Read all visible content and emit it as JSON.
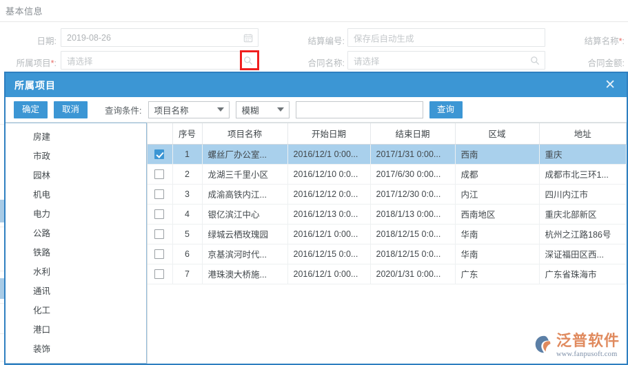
{
  "background_form": {
    "section_title": "基本信息",
    "fields": [
      {
        "label": "日期:",
        "required": false,
        "value": "2019-08-26",
        "placeholder": "",
        "icon": "calendar-icon"
      },
      {
        "label": "结算编号:",
        "required": false,
        "value": "",
        "placeholder": "保存后自动生成",
        "icon": ""
      },
      {
        "label": "结算名称",
        "required": true,
        "value": "",
        "placeholder": "",
        "icon": ""
      },
      {
        "label": "所属项目",
        "required": true,
        "value": "",
        "placeholder": "请选择",
        "icon": "search-icon"
      },
      {
        "label": "合同名称:",
        "required": false,
        "value": "",
        "placeholder": "请选择",
        "icon": "search-icon"
      },
      {
        "label": "合同金额:",
        "required": false,
        "value": "",
        "placeholder": "",
        "icon": ""
      }
    ],
    "highlight_color": "#f01f1f"
  },
  "dialog": {
    "title": "所属项目",
    "close_label": "✕",
    "accent_color": "#3c96d4",
    "toolbar": {
      "confirm_label": "确定",
      "cancel_label": "取消",
      "condition_label": "查询条件:",
      "field_select": "项目名称",
      "match_select": "模糊",
      "keyword_value": "",
      "keyword_placeholder": "",
      "query_label": "查询"
    },
    "sidebar": {
      "items": [
        "房建",
        "市政",
        "园林",
        "机电",
        "电力",
        "公路",
        "铁路",
        "水利",
        "通讯",
        "化工",
        "港口",
        "装饰"
      ]
    },
    "table": {
      "columns": [
        "",
        "序号",
        "项目名称",
        "开始日期",
        "结束日期",
        "区域",
        "地址"
      ],
      "rows": [
        {
          "checked": true,
          "selected": true,
          "index": "1",
          "name": "螺丝厂办公室...",
          "start": "2016/12/1 0:00...",
          "end": "2017/1/31 0:00...",
          "region": "西南",
          "address": "重庆"
        },
        {
          "checked": false,
          "selected": false,
          "index": "2",
          "name": "龙湖三千里小区",
          "start": "2016/12/10 0:0...",
          "end": "2017/6/30 0:00...",
          "region": "成都",
          "address": "成都市北三环1..."
        },
        {
          "checked": false,
          "selected": false,
          "index": "3",
          "name": "成渝高铁内江...",
          "start": "2016/12/12 0:0...",
          "end": "2017/12/30 0:0...",
          "region": "内江",
          "address": "四川内江市"
        },
        {
          "checked": false,
          "selected": false,
          "index": "4",
          "name": "银亿滨江中心",
          "start": "2016/12/13 0:0...",
          "end": "2018/1/13 0:00...",
          "region": "西南地区",
          "address": "重庆北部新区"
        },
        {
          "checked": false,
          "selected": false,
          "index": "5",
          "name": "绿城云栖玫瑰园",
          "start": "2016/12/1 0:00...",
          "end": "2018/12/15 0:0...",
          "region": "华南",
          "address": "杭州之江路186号"
        },
        {
          "checked": false,
          "selected": false,
          "index": "6",
          "name": "京基滨河时代...",
          "start": "2016/12/15 0:0...",
          "end": "2018/12/15 0:0...",
          "region": "华南",
          "address": "深证福田区西..."
        },
        {
          "checked": false,
          "selected": false,
          "index": "7",
          "name": "港珠澳大桥施...",
          "start": "2016/12/1 0:00...",
          "end": "2020/1/31 0:00...",
          "region": "广东",
          "address": "广东省珠海市"
        }
      ]
    }
  },
  "watermark": {
    "brand_cn": "泛普软件",
    "brand_url": "www.fanpusoft.com",
    "brand_color": "#e08a5e"
  }
}
